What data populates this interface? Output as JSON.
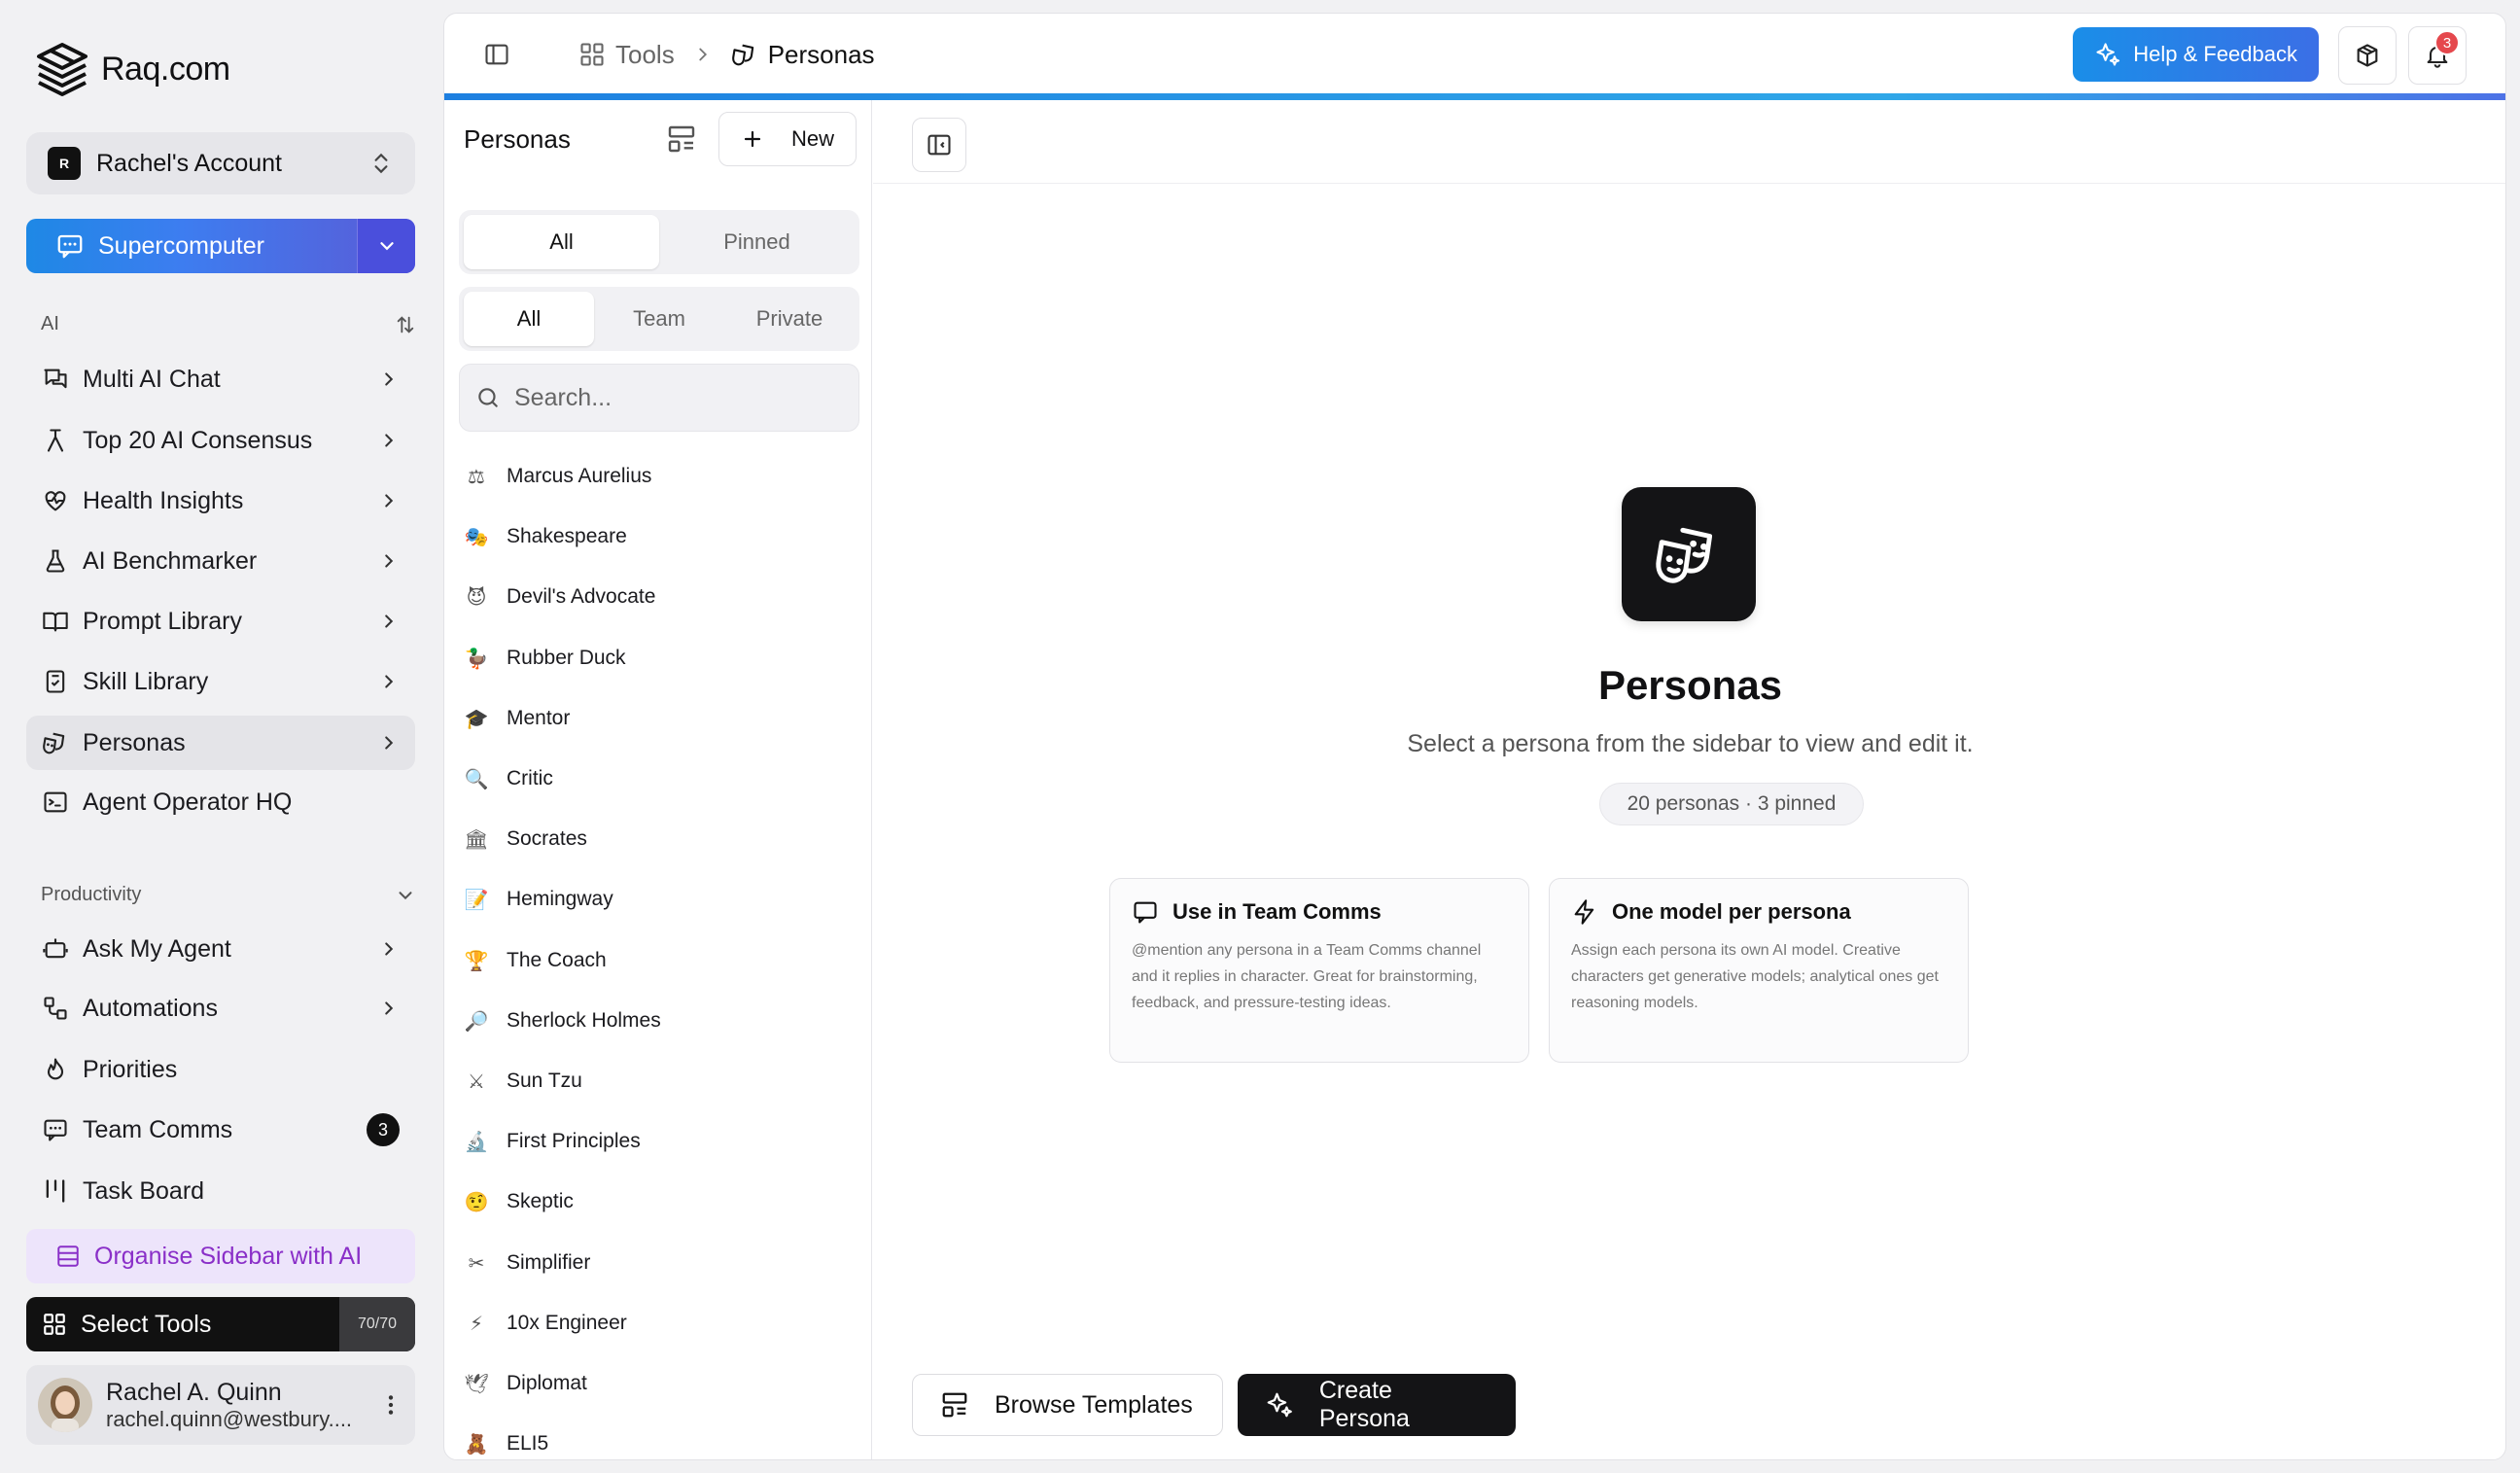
{
  "sidebar": {
    "brand": "Raq.com",
    "account": {
      "badge": "R",
      "name": "Rachel's Account"
    },
    "supercomputer": "Supercomputer",
    "ai_section": "AI",
    "ai_items": [
      {
        "label": "Multi AI Chat",
        "icon": "chat-icon"
      },
      {
        "label": "Top 20 AI Consensus",
        "icon": "merge-icon"
      },
      {
        "label": "Health Insights",
        "icon": "heart-pulse-icon"
      },
      {
        "label": "AI Benchmarker",
        "icon": "flask-icon"
      },
      {
        "label": "Prompt Library",
        "icon": "book-icon"
      },
      {
        "label": "Skill Library",
        "icon": "clipboard-check-icon"
      },
      {
        "label": "Personas",
        "icon": "theater-masks-icon",
        "active": true
      },
      {
        "label": "Agent Operator HQ",
        "icon": "terminal-icon"
      }
    ],
    "productivity_section": "Productivity",
    "productivity_items": [
      {
        "label": "Ask My Agent",
        "icon": "bot-icon"
      },
      {
        "label": "Automations",
        "icon": "workflow-icon"
      },
      {
        "label": "Priorities",
        "icon": "flame-icon"
      },
      {
        "label": "Team Comms",
        "icon": "message-icon",
        "count": "3"
      },
      {
        "label": "Task Board",
        "icon": "kanban-icon"
      }
    ],
    "organise": "Organise Sidebar with AI",
    "select_tools": {
      "label": "Select Tools",
      "meter": "70/70"
    },
    "user": {
      "name": "Rachel A. Quinn",
      "email": "rachel.quinn@westbury...."
    }
  },
  "topbar": {
    "crumb_tools": "Tools",
    "crumb_current": "Personas",
    "help": "Help & Feedback",
    "notifications": "3"
  },
  "list": {
    "title": "Personas",
    "new_label": "New",
    "filter1": [
      "All",
      "Pinned"
    ],
    "filter2": [
      "All",
      "Team",
      "Private"
    ],
    "search_placeholder": "Search...",
    "personas": [
      {
        "name": "Marcus Aurelius",
        "emoji": "⚖"
      },
      {
        "name": "Shakespeare",
        "emoji": "🎭"
      },
      {
        "name": "Devil's Advocate",
        "emoji": "😈"
      },
      {
        "name": "Rubber Duck",
        "emoji": "🦆"
      },
      {
        "name": "Mentor",
        "emoji": "🎓"
      },
      {
        "name": "Critic",
        "emoji": "🔍"
      },
      {
        "name": "Socrates",
        "emoji": "🏛"
      },
      {
        "name": "Hemingway",
        "emoji": "📝"
      },
      {
        "name": "The Coach",
        "emoji": "🏆"
      },
      {
        "name": "Sherlock Holmes",
        "emoji": "🔎"
      },
      {
        "name": "Sun Tzu",
        "emoji": "⚔"
      },
      {
        "name": "First Principles",
        "emoji": "🔬"
      },
      {
        "name": "Skeptic",
        "emoji": "🤨"
      },
      {
        "name": "Simplifier",
        "emoji": "✂"
      },
      {
        "name": "10x Engineer",
        "emoji": "⚡"
      },
      {
        "name": "Diplomat",
        "emoji": "🕊"
      },
      {
        "name": "ELI5",
        "emoji": "🧸"
      }
    ]
  },
  "detail": {
    "title": "Personas",
    "subtitle": "Select a persona from the sidebar to view and edit it.",
    "stats": "20 personas · 3 pinned",
    "card1": {
      "title": "Use in Team Comms",
      "body": "@mention any persona in a Team Comms channel and it replies in character. Great for brainstorming, feedback, and pressure-testing ideas."
    },
    "card2": {
      "title": "One model per persona",
      "body": "Assign each persona its own AI model. Creative characters get generative models; analytical ones get reasoning models."
    },
    "browse": "Browse Templates",
    "create": "Create Persona"
  }
}
